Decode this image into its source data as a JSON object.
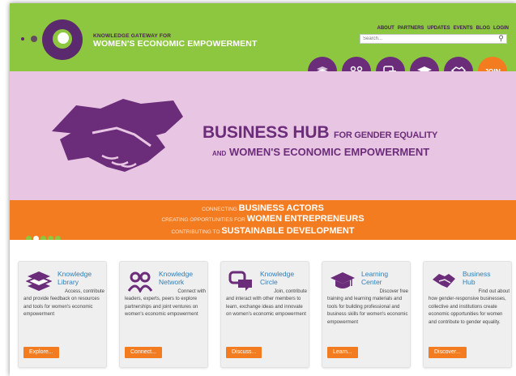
{
  "brand": {
    "top": "KNOWLEDGE GATEWAY FOR",
    "main": "WOMEN'S ECONOMIC EMPOWERMENT"
  },
  "nav": [
    "ABOUT",
    "PARTNERS",
    "UPDATES",
    "EVENTS",
    "BLOG",
    "LOGIN"
  ],
  "search": {
    "placeholder": "Search..."
  },
  "circle_buttons": [
    {
      "icon": "books-icon"
    },
    {
      "icon": "network-icon"
    },
    {
      "icon": "chat-icon"
    },
    {
      "icon": "graduation-cap-icon"
    },
    {
      "icon": "handshake-icon"
    }
  ],
  "join_label": "JOIN",
  "hero": {
    "title": "BUSINESS HUB",
    "title_small": "FOR GENDER EQUALITY",
    "sub_small": "AND",
    "sub": "WOMEN'S ECONOMIC EMPOWERMENT"
  },
  "banner": [
    {
      "pre": "CONNECTING ",
      "bold": "BUSINESS ACTORS"
    },
    {
      "pre": "CREATING OPPORTUNITIES FOR ",
      "bold": "WOMEN ENTREPRENEURS"
    },
    {
      "pre": "CONTRIBUTING TO ",
      "bold": "SUSTAINABLE DEVELOPMENT"
    }
  ],
  "slider": {
    "count": 5,
    "active": 1
  },
  "cards": [
    {
      "title1": "Knowledge",
      "title2": "Library",
      "first": "Access, contribute",
      "rest": "and provide feedback on resources and tools for women's economic empowerment",
      "button": "Explore..."
    },
    {
      "title1": "Knowledge",
      "title2": "Network",
      "first": "Connect with",
      "rest": "leaders, experts, peers to explore partnerships and joint ventures on women's economic empowerment",
      "button": "Connect..."
    },
    {
      "title1": "Knowledge",
      "title2": "Circle",
      "first": "Join, contribute",
      "rest": "and interact with other members to learn, exchange ideas and innovate on women's economic empowerment",
      "button": "Discuss..."
    },
    {
      "title1": "Learning",
      "title2": "Center",
      "first": "Discover free",
      "rest": "training and learning materials and tools for building professional and business skills for women's economic empowerment",
      "button": "Learn..."
    },
    {
      "title1": "Business",
      "title2": "Hub",
      "first": "Find out about",
      "rest": "how gender-responsive businesses, collective and institutions create economic opportunities for women and contribute to gender equality.",
      "button": "Discover..."
    }
  ],
  "colors": {
    "green": "#8dc63f",
    "purple": "#6b2c79",
    "orange": "#f47c20",
    "pink": "#e8c6e3",
    "link_blue": "#2d7fb8"
  }
}
